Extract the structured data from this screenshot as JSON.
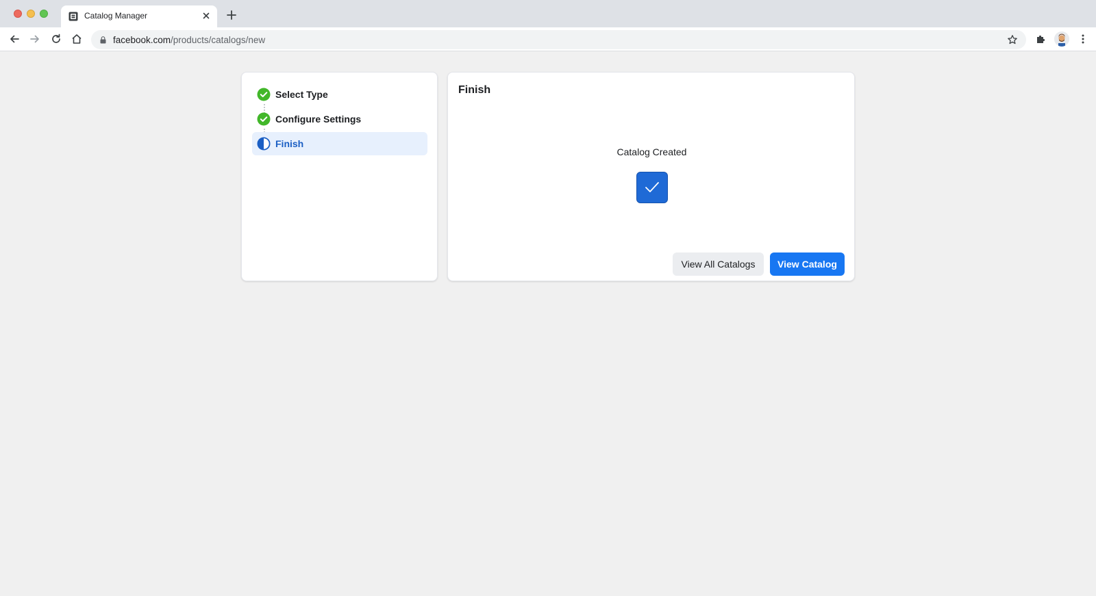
{
  "browser": {
    "tab_title": "Catalog Manager",
    "url_domain": "facebook.com",
    "url_path": "/products/catalogs/new"
  },
  "steps": [
    {
      "label": "Select Type",
      "status": "complete",
      "icon": "check-circle-icon"
    },
    {
      "label": "Configure Settings",
      "status": "complete",
      "icon": "check-circle-icon"
    },
    {
      "label": "Finish",
      "status": "current",
      "icon": "half-circle-icon"
    }
  ],
  "main": {
    "title": "Finish",
    "status_text": "Catalog Created",
    "status_icon": "checkmark-icon",
    "buttons": {
      "secondary": "View All Catalogs",
      "primary": "View Catalog"
    }
  },
  "colors": {
    "primary_blue": "#1877f2",
    "success_green": "#42b72a",
    "active_step_bg": "#e7f0fd",
    "success_box": "#1f6ad6"
  }
}
